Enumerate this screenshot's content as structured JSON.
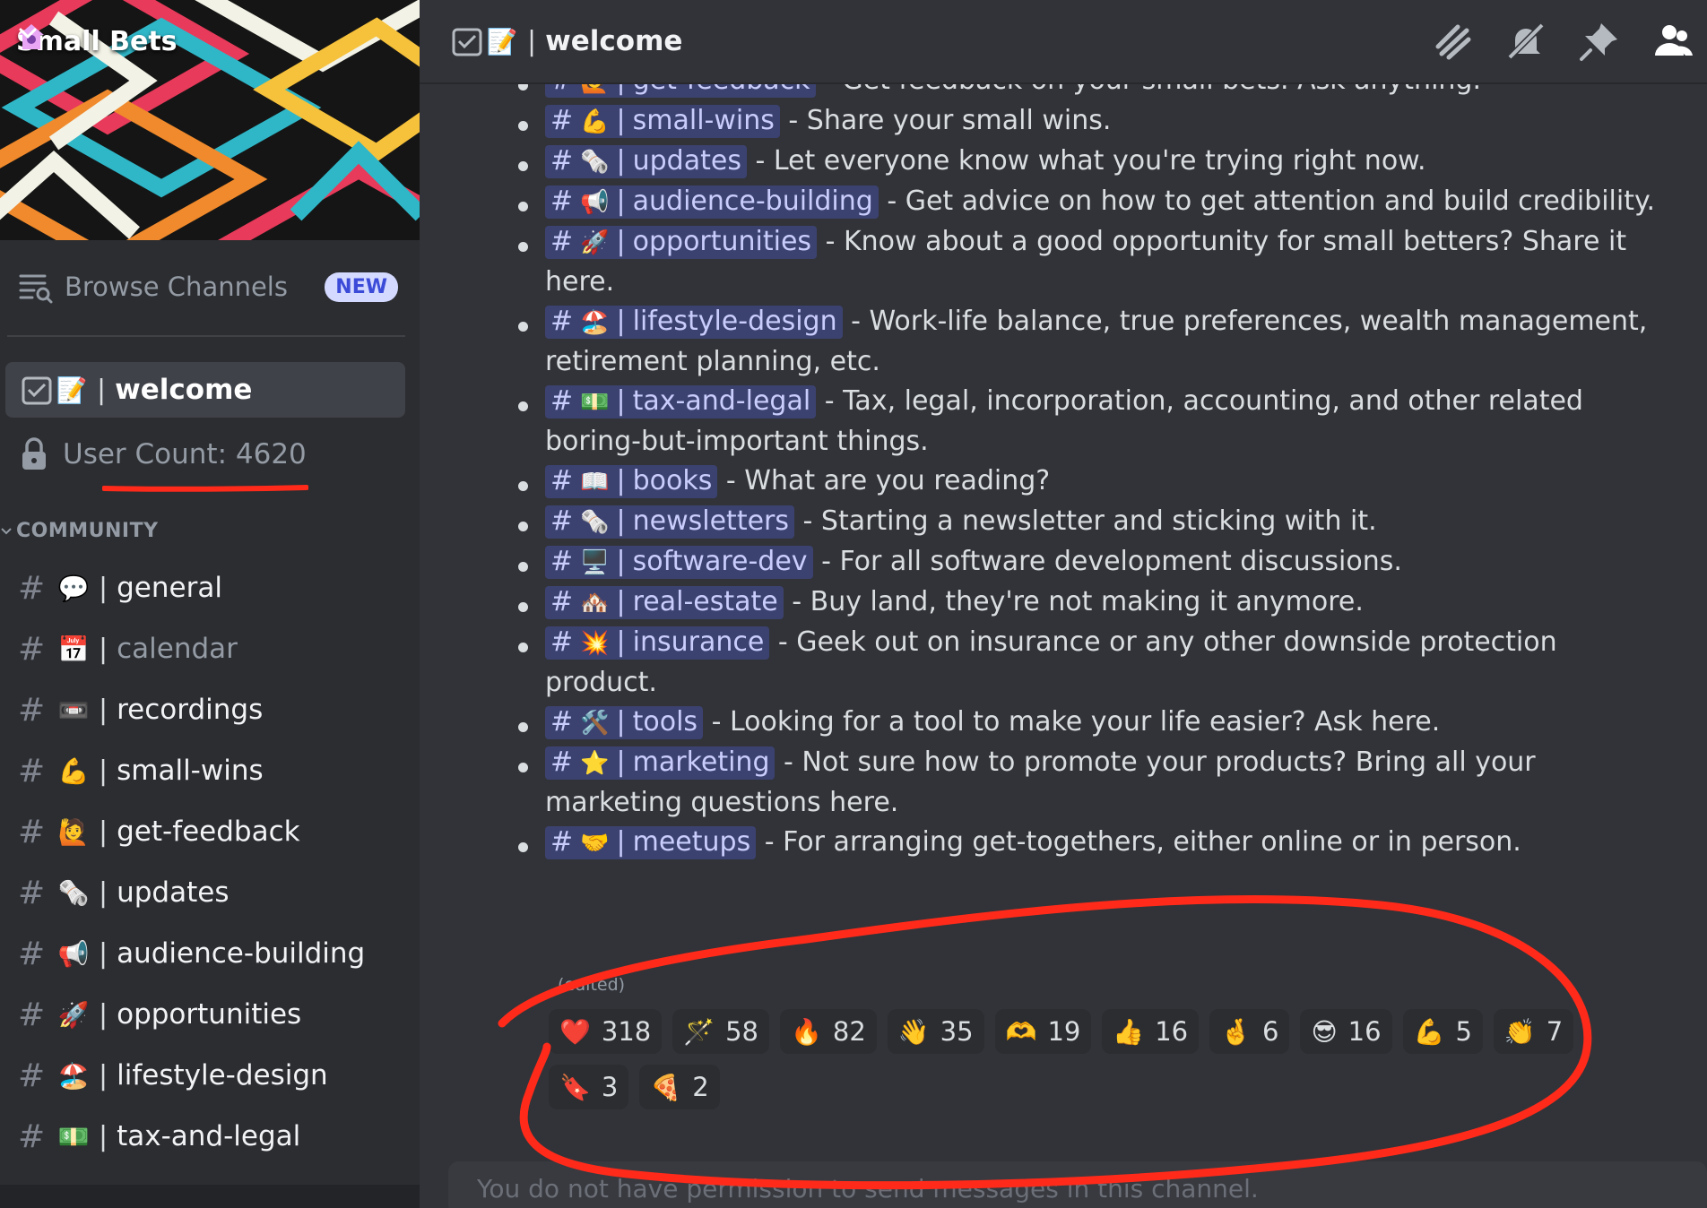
{
  "server": {
    "name": "Small Bets"
  },
  "sidebar": {
    "browse_label": "Browse Channels",
    "browse_badge": "NEW",
    "active_channel": {
      "emoji": "📝",
      "sep": "|",
      "name": "welcome"
    },
    "user_count_label": "User Count: 4620",
    "category": "COMMUNITY",
    "channels": [
      {
        "emoji": "💬",
        "name": "general"
      },
      {
        "emoji": "📅",
        "name": "calendar"
      },
      {
        "emoji": "📼",
        "name": "recordings"
      },
      {
        "emoji": "💪",
        "name": "small-wins"
      },
      {
        "emoji": "🙋",
        "name": "get-feedback"
      },
      {
        "emoji": "🗞️",
        "name": "updates"
      },
      {
        "emoji": "📢",
        "name": "audience-building"
      },
      {
        "emoji": "🚀",
        "name": "opportunities"
      },
      {
        "emoji": "🏖️",
        "name": "lifestyle-design"
      },
      {
        "emoji": "💵",
        "name": "tax-and-legal"
      }
    ]
  },
  "header": {
    "emoji": "📝",
    "sep": "|",
    "channel": "welcome"
  },
  "message": {
    "items": [
      {
        "emoji": "🙋",
        "channel": "get-feedback",
        "text": " - Get feedback on your small bets. Ask anything."
      },
      {
        "emoji": "💪",
        "channel": "small-wins",
        "text": " - Share your small wins."
      },
      {
        "emoji": "🗞️",
        "channel": "updates",
        "text": " - Let everyone know what you're trying right now."
      },
      {
        "emoji": "📢",
        "channel": "audience-building",
        "text": " - Get advice on how to get attention and build credibility."
      },
      {
        "emoji": "🚀",
        "channel": "opportunities",
        "text": " - Know about a good opportunity for small betters? Share it here."
      },
      {
        "emoji": "🏖️",
        "channel": "lifestyle-design",
        "text": " -  Work-life balance, true preferences, wealth management, retirement planning, etc."
      },
      {
        "emoji": "💵",
        "channel": "tax-and-legal",
        "text": " - Tax, legal, incorporation, accounting, and other related boring-but-important things."
      },
      {
        "emoji": "📖",
        "channel": "books",
        "text": " - What are you reading?"
      },
      {
        "emoji": "🗞️",
        "channel": "newsletters",
        "text": " - Starting a newsletter and sticking with it."
      },
      {
        "emoji": "🖥️",
        "channel": "software-dev",
        "text": " - For all software development discussions."
      },
      {
        "emoji": "🏘️",
        "channel": "real-estate",
        "text": " - Buy land, they're not making it anymore."
      },
      {
        "emoji": "💥",
        "channel": "insurance",
        "text": " - Geek out on insurance or any other downside protection product."
      },
      {
        "emoji": "🛠️",
        "channel": "tools",
        "text": " - Looking for a tool to make your life easier? Ask here."
      },
      {
        "emoji": "⭐",
        "channel": "marketing",
        "text": " - Not sure how to promote your products? Bring all your marketing questions here."
      },
      {
        "emoji": "🤝",
        "channel": "meetups",
        "text": " - For arranging get-togethers, either online or in person."
      }
    ],
    "edited": "(edited)",
    "reactions": [
      {
        "emoji": "❤️",
        "count": "318"
      },
      {
        "emoji": "🪄",
        "count": "58"
      },
      {
        "emoji": "🔥",
        "count": "82"
      },
      {
        "emoji": "👋",
        "count": "35"
      },
      {
        "emoji": "🫶",
        "count": "19"
      },
      {
        "emoji": "👍",
        "count": "16"
      },
      {
        "emoji": "🤞",
        "count": "6"
      },
      {
        "emoji": "😎",
        "count": "16"
      },
      {
        "emoji": "💪",
        "count": "5"
      },
      {
        "emoji": "👏",
        "count": "7"
      },
      {
        "emoji": "🔖",
        "count": "3"
      },
      {
        "emoji": "🍕",
        "count": "2"
      }
    ]
  },
  "composer": {
    "placeholder": "You do not have permission to send messages in this channel."
  },
  "colors": {
    "annotation": "#ff2a1a",
    "mention_bg": "#3c4270",
    "sidebar_bg": "#2b2d31",
    "main_bg": "#313338"
  }
}
